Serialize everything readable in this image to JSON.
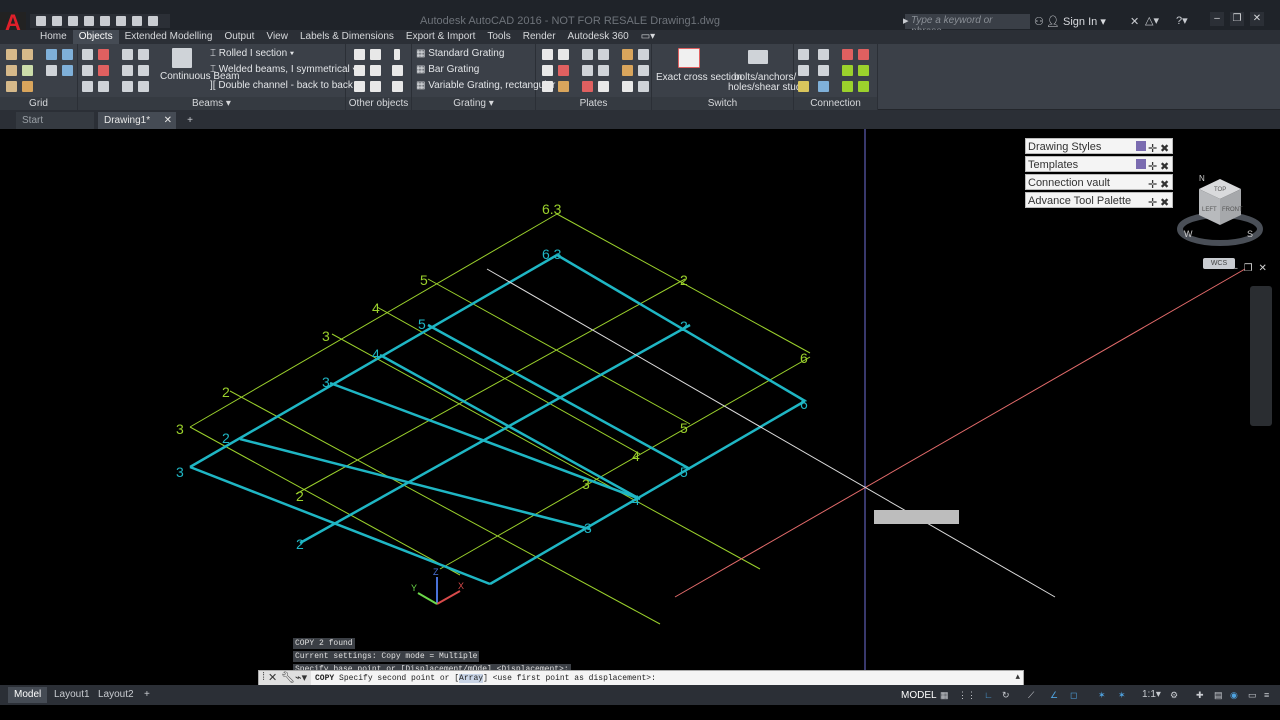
{
  "titlebar": {
    "window_title": "Autodesk AutoCAD 2016 - NOT FOR RESALE    Drawing1.dwg",
    "search_placeholder": "Type a keyword or phrase",
    "sign_in": "Sign In"
  },
  "ribbon_tabs": [
    "Home",
    "Objects",
    "Extended Modelling",
    "Output",
    "View",
    "Labels & Dimensions",
    "Export & Import",
    "Tools",
    "Render",
    "Autodesk 360"
  ],
  "active_tab": "Objects",
  "ribbon": {
    "grid_title": "Grid",
    "beams": {
      "continuous_beam": "Continuous Beam",
      "rolled_i_section": "Rolled I section",
      "welded_beams": "Welded beams, I symmetrical",
      "double_channel": "Double channel - back to back",
      "title": "Beams"
    },
    "other_objects_title": "Other objects",
    "grating": {
      "standard": "Standard Grating",
      "bar": "Bar Grating",
      "variable": "Variable Grating, rectangular",
      "title": "Grating"
    },
    "plates_title": "Plates",
    "switch": {
      "exact_cross_section": "Exact cross section",
      "bolts_line1": "bolts/anchors/",
      "bolts_line2": "holes/shear studs",
      "title": "Switch"
    },
    "connection_objects_title": "Connection objects"
  },
  "doc_tabs": {
    "start": "Start",
    "drawing": "Drawing1*",
    "add": "+"
  },
  "palettes": [
    "Drawing Styles",
    "Templates",
    "Connection vault",
    "Advance Tool Palette"
  ],
  "viewcube": {
    "top_label": "TOP",
    "left_label": "LEFT",
    "front_label": "FRONT",
    "compass_n": "N",
    "compass_w": "W",
    "compass_s": "S",
    "wcs": "WCS"
  },
  "grid_labels": {
    "outer_top": "6.3",
    "inner_top": "6.3",
    "outer_left": "3",
    "inner_left": "3",
    "row_labels_outer": [
      "5",
      "4",
      "3",
      "2"
    ],
    "row_labels_inner": [
      "5",
      "4",
      "3",
      "2"
    ],
    "col_labels_outer_right": [
      "2",
      "6"
    ],
    "col_labels_inner_right": [
      "2",
      "6"
    ],
    "bottom_outer": [
      "2",
      "3",
      "4",
      "5"
    ],
    "bottom_inner": [
      "2",
      "3",
      "4",
      "5"
    ]
  },
  "ucs": {
    "x": "X",
    "y": "Y",
    "z": "Z"
  },
  "command_history": [
    "COPY 2 found",
    "Current settings:  Copy mode = Multiple",
    "Specify base point or [Displacement/mOde] <Displacement>:"
  ],
  "command_line": {
    "prefix": "COPY",
    "text_before": "Specify second point or [",
    "option": "Array",
    "text_after": "] <use first point as displacement>:"
  },
  "status_tabs": {
    "model": "Model",
    "layout1": "Layout1",
    "layout2": "Layout2",
    "add": "+"
  },
  "status": {
    "model_label": "MODEL",
    "scale": "1:1"
  },
  "colors": {
    "grid_cyan": "#1fb6c4",
    "grid_green": "#9bd12c",
    "crosshair_red": "#e36b6b",
    "crosshair_white": "#dcdcdc",
    "crosshair_blue": "#6f6fd8"
  }
}
